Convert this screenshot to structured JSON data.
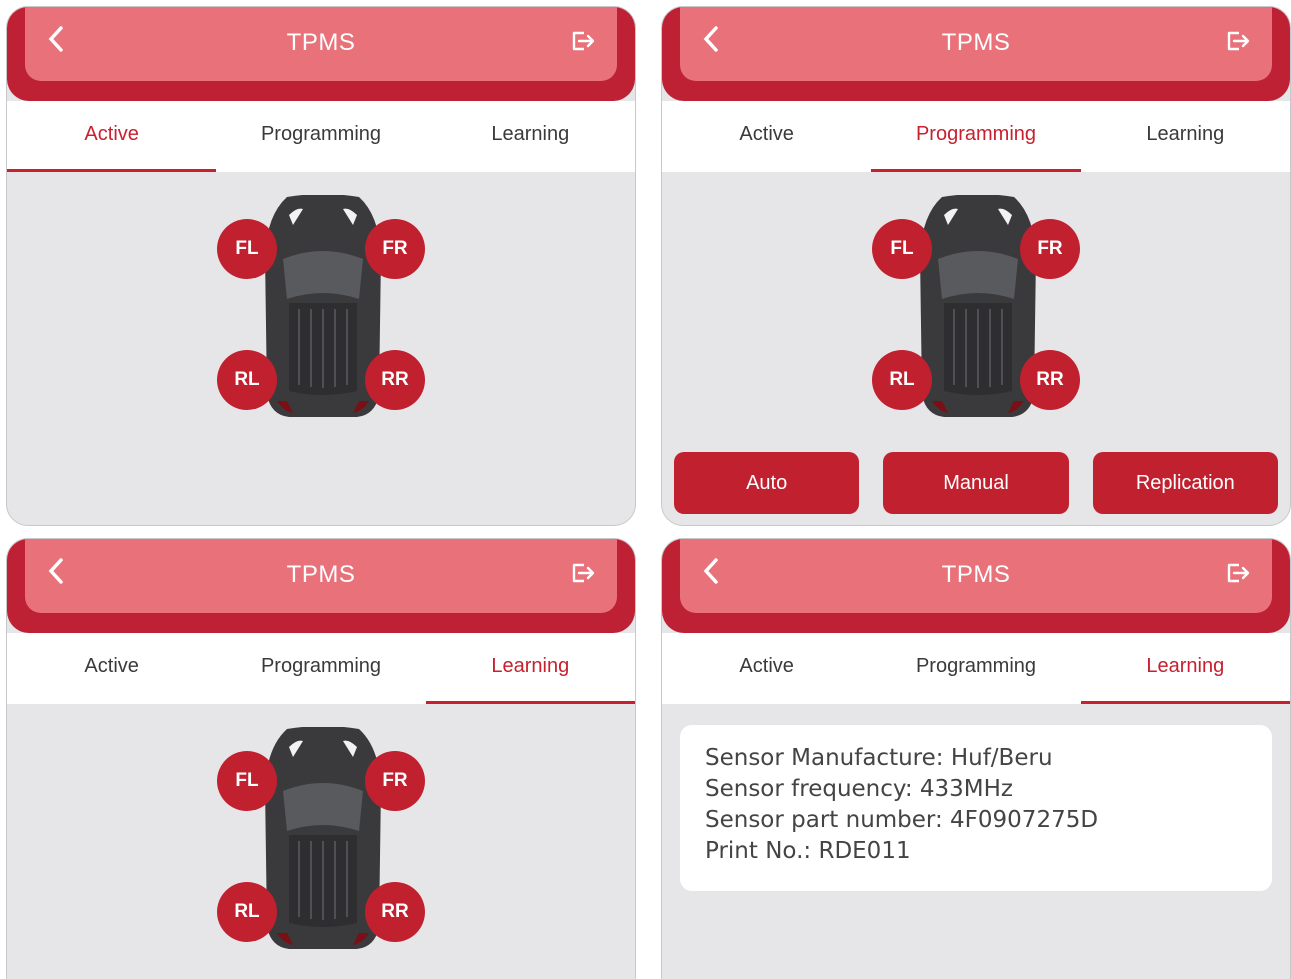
{
  "app": {
    "title": "TPMS",
    "tabs": [
      "Active",
      "Programming",
      "Learning"
    ]
  },
  "panels": [
    {
      "active_tab": "Active"
    },
    {
      "active_tab": "Programming",
      "buttons": [
        "Auto",
        "Manual",
        "Replication"
      ]
    },
    {
      "active_tab": "Learning"
    },
    {
      "active_tab": "Learning"
    }
  ],
  "wheels": {
    "fl": "FL",
    "fr": "FR",
    "rl": "RL",
    "rr": "RR"
  },
  "sensor_info": {
    "manufacture": "Sensor Manufacture: Huf/Beru",
    "frequency": "Sensor frequency: 433MHz",
    "part_number": "Sensor part number: 4F0907275D",
    "print_no": "Print No.: RDE011"
  },
  "icons": {
    "back": "chevron-left-icon",
    "exit": "exit-icon",
    "car": "car-top-view-icon"
  },
  "colors": {
    "primary": "#c1202f",
    "header_light": "#e8717a",
    "background": "#e6e6e8"
  }
}
